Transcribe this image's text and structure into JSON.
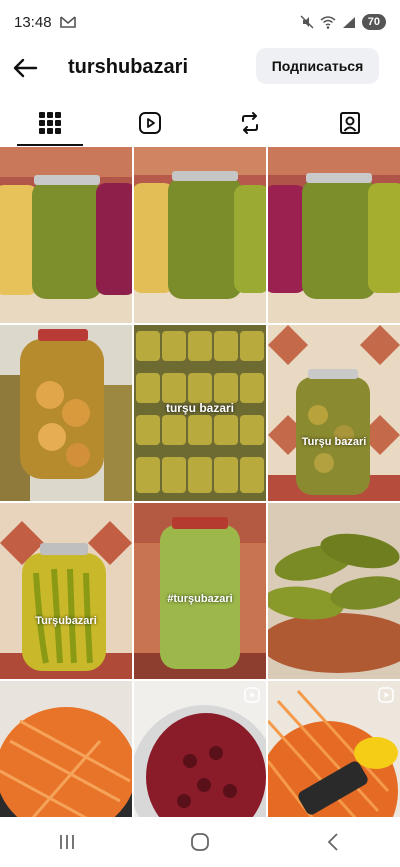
{
  "status_bar": {
    "time": "13:48",
    "battery": "70"
  },
  "header": {
    "username": "turshubazari",
    "follow_label": "Подписаться"
  },
  "tabs": [
    {
      "name": "posts-grid",
      "active": true
    },
    {
      "name": "reels"
    },
    {
      "name": "reposts"
    },
    {
      "name": "tagged"
    }
  ],
  "grid_items": [
    {
      "id": 1,
      "text": "",
      "reel": false
    },
    {
      "id": 2,
      "text": "",
      "reel": false
    },
    {
      "id": 3,
      "text": "",
      "reel": false
    },
    {
      "id": 4,
      "text": "",
      "reel": false
    },
    {
      "id": 5,
      "text": "turşu bazari",
      "reel": false
    },
    {
      "id": 6,
      "text": "Turşu bazari",
      "reel": false
    },
    {
      "id": 7,
      "text": "Turşubazari",
      "reel": false
    },
    {
      "id": 8,
      "text": "#turşubazari",
      "reel": false
    },
    {
      "id": 9,
      "text": "",
      "reel": false
    },
    {
      "id": 10,
      "text": "",
      "reel": false
    },
    {
      "id": 11,
      "text": "",
      "reel": true
    },
    {
      "id": 12,
      "text": "",
      "reel": true
    }
  ],
  "colors": {
    "accent": "#111111",
    "follow_bg": "#eef0f3",
    "pickle": "#8a9a2a",
    "carrot": "#e8742a"
  }
}
